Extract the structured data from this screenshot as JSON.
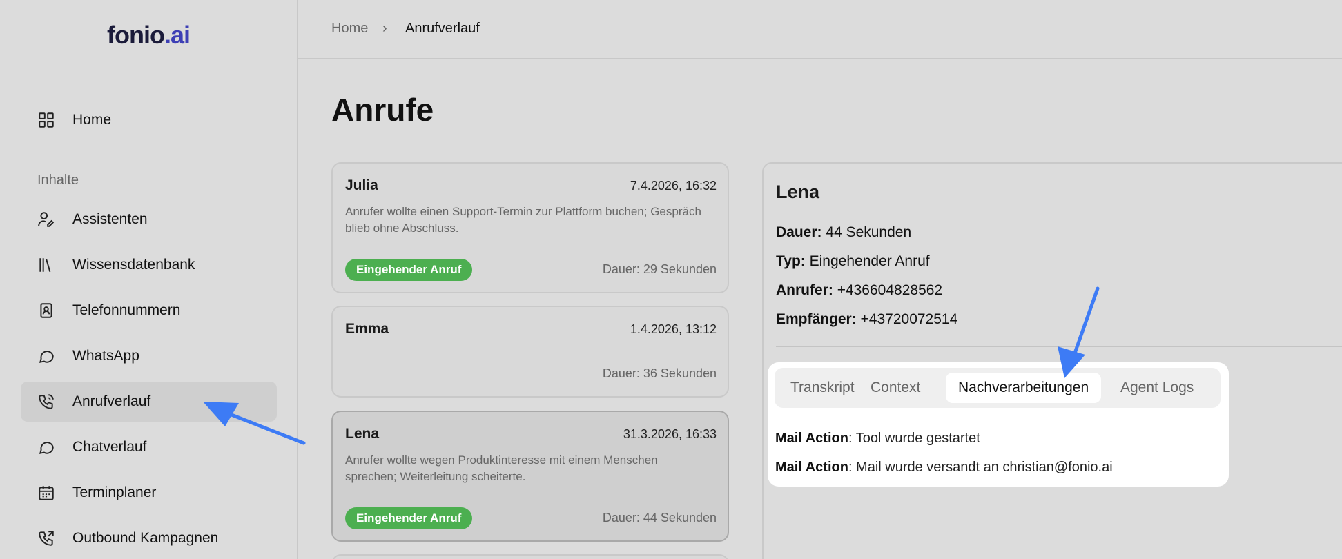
{
  "logo": {
    "brand": "fonio",
    "suffix": ".ai"
  },
  "sidebar": {
    "home": "Home",
    "section": "Inhalte",
    "items": [
      {
        "label": "Assistenten",
        "icon": "user-pen-icon"
      },
      {
        "label": "Wissensdatenbank",
        "icon": "library-icon"
      },
      {
        "label": "Telefonnummern",
        "icon": "contact-book-icon"
      },
      {
        "label": "WhatsApp",
        "icon": "chat-bubble-icon"
      },
      {
        "label": "Anrufverlauf",
        "icon": "phone-call-icon"
      },
      {
        "label": "Chatverlauf",
        "icon": "chat-bubble-icon"
      },
      {
        "label": "Terminplaner",
        "icon": "calendar-icon"
      },
      {
        "label": "Outbound Kampagnen",
        "icon": "phone-outgoing-icon"
      }
    ],
    "active": "Anrufverlauf"
  },
  "breadcrumb": {
    "home": "Home",
    "sep": "›",
    "current": "Anrufverlauf"
  },
  "page": {
    "title": "Anrufe"
  },
  "calls": [
    {
      "name": "Julia",
      "date": "7.4.2026, 16:32",
      "desc": "Anrufer wollte einen Support-Termin zur Plattform buchen; Gespräch blieb ohne Abschluss.",
      "tag": "Eingehender Anruf",
      "duration": "Dauer: 29 Sekunden"
    },
    {
      "name": "Emma",
      "date": "1.4.2026, 13:12",
      "desc": "",
      "tag": "",
      "duration": "Dauer: 36 Sekunden"
    },
    {
      "name": "Lena",
      "date": "31.3.2026, 16:33",
      "desc": "Anrufer wollte wegen Produktinteresse mit einem Menschen sprechen; Weiterleitung scheiterte.",
      "tag": "Eingehender Anruf",
      "duration": "Dauer: 44 Sekunden"
    }
  ],
  "detail": {
    "name": "Lena",
    "fields": [
      {
        "key": "Dauer:",
        "value": "44 Sekunden"
      },
      {
        "key": "Typ:",
        "value": "Eingehender Anruf"
      },
      {
        "key": "Anrufer:",
        "value": "+436604828562"
      },
      {
        "key": "Empfänger:",
        "value": "+43720072514"
      }
    ],
    "tabs": [
      "Transkript",
      "Context",
      "Nachverarbeitungen",
      "Agent Logs"
    ],
    "active_tab": "Nachverarbeitungen",
    "actions": [
      {
        "key": "Mail Action",
        "value": ": Tool wurde gestartet"
      },
      {
        "key": "Mail Action",
        "value": ": Mail wurde versandt an christian@fonio.ai"
      }
    ]
  },
  "colors": {
    "accent": "#3d7bf5",
    "tag_green": "#4caf50",
    "logo_ai": "#3d3fb5"
  }
}
